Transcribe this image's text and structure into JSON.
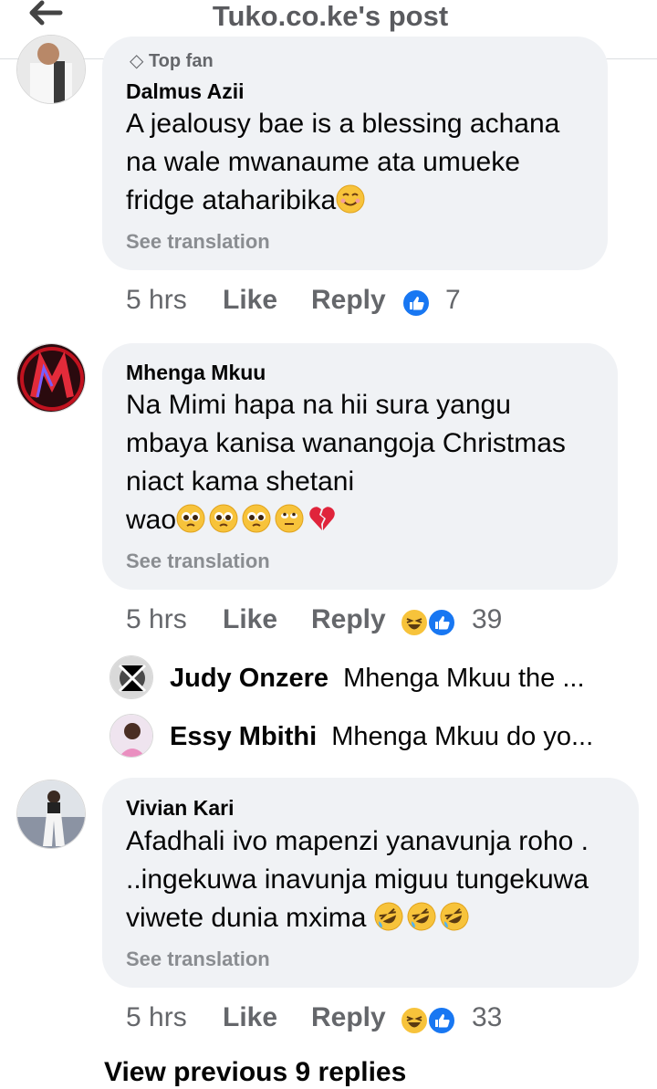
{
  "header": {
    "title": "Tuko.co.ke's post"
  },
  "comments": [
    {
      "badge": "Top fan",
      "author": "Dalmus Azii",
      "lines": [
        "A jealousy bae is a blessing achana",
        "na wale mwanaume ata umueke",
        "fridge ataharibika"
      ],
      "see_translation": "See translation",
      "time": "5 hrs",
      "like": "Like",
      "reply": "Reply",
      "reactions": [
        "like"
      ],
      "reaction_count": "7"
    },
    {
      "author": "Mhenga Mkuu",
      "lines": [
        "Na Mimi hapa na hii sura yangu",
        "mbaya kanisa wanangoja Christmas",
        "niact kama shetani",
        "wao"
      ],
      "see_translation": "See translation",
      "time": "5 hrs",
      "like": "Like",
      "reply": "Reply",
      "reactions": [
        "haha",
        "like"
      ],
      "reaction_count": "39",
      "replies": [
        {
          "author": "Judy Onzere",
          "snippet": "Mhenga Mkuu the ..."
        },
        {
          "author": "Essy Mbithi",
          "snippet": "Mhenga Mkuu do yo..."
        }
      ]
    },
    {
      "author": "Vivian Kari",
      "lines": [
        "Afadhali ivo mapenzi yanavunja roho .",
        "..ingekuwa inavunja miguu tungekuwa",
        "viwete dunia mxima"
      ],
      "see_translation": "See translation",
      "time": "5 hrs",
      "like": "Like",
      "reply": "Reply",
      "reactions": [
        "haha",
        "like"
      ],
      "reaction_count": "33"
    }
  ],
  "view_previous": "View previous 9 replies",
  "colors": {
    "like_blue": "#1877f2",
    "bubble_bg": "#f0f2f5",
    "muted_text": "#65676b"
  }
}
